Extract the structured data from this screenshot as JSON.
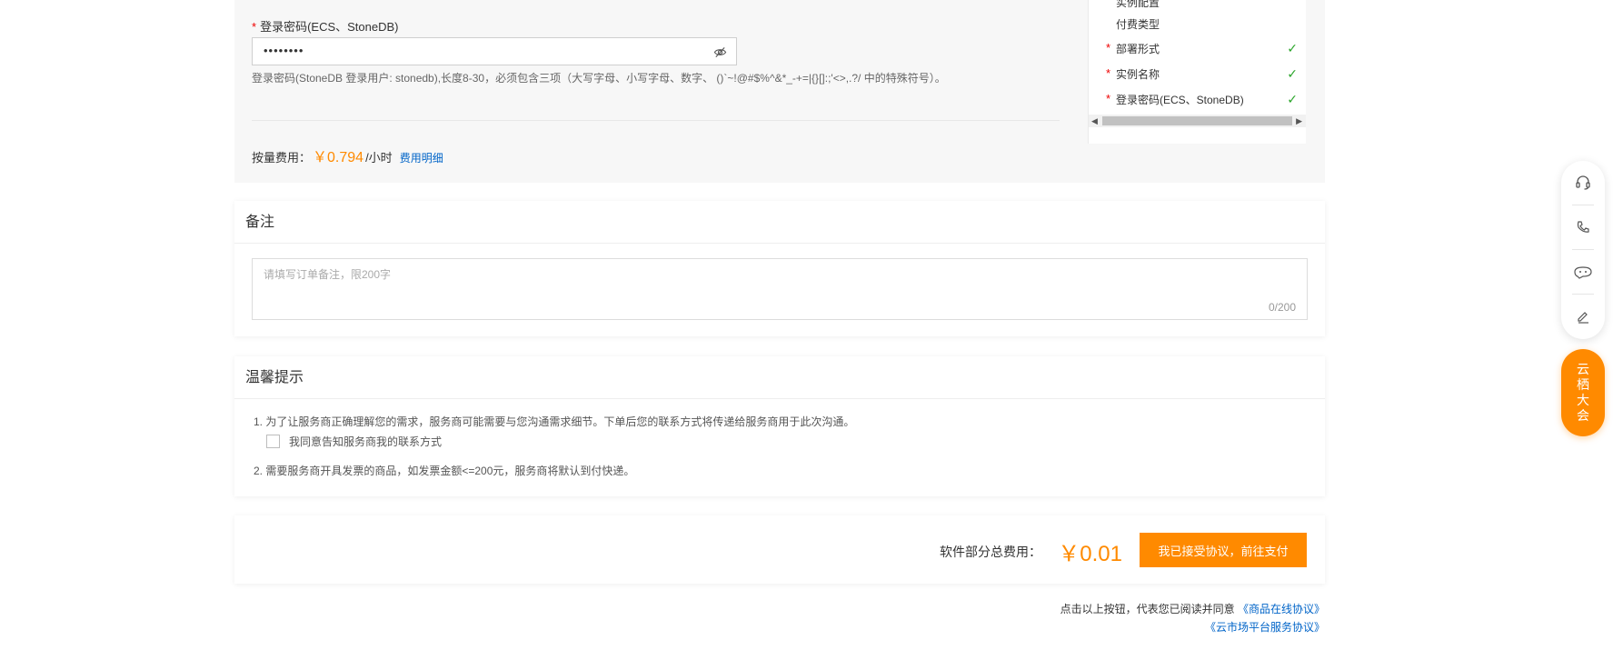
{
  "top_section": {
    "password_label": "登录密码(ECS、StoneDB)",
    "password_value": "••••••••",
    "password_hint": "登录密码(StoneDB 登录用户: stonedb),长度8-30，必须包含三项（大写字母、小写字母、数字、 ()`~!@#$%^&*_-+=|{}[]:;'<>,.?/ 中的特殊符号）。",
    "price_label": "按量费用：",
    "price_value": "￥0.794",
    "price_unit": "/小时",
    "price_link": "费用明细"
  },
  "nav_panel": {
    "items": [
      {
        "label": "实例配置",
        "required": false,
        "done": false
      },
      {
        "label": "付费类型",
        "required": false,
        "done": false
      },
      {
        "label": "部署形式",
        "required": true,
        "done": true
      },
      {
        "label": "实例名称",
        "required": true,
        "done": true
      },
      {
        "label": "登录密码(ECS、StoneDB)",
        "required": true,
        "done": true
      }
    ],
    "check_mark": "✓",
    "required_mark": "*"
  },
  "remarks": {
    "title": "备注",
    "placeholder": "请填写订单备注，限200字",
    "counter": "0/200"
  },
  "tips": {
    "title": "温馨提示",
    "line1": "1. 为了让服务商正确理解您的需求，服务商可能需要与您沟通需求细节。下单后您的联系方式将传递给服务商用于此次沟通。",
    "agree_label": "我同意告知服务商我的联系方式",
    "line2": "2. 需要服务商开具发票的商品，如发票金额<=200元，服务商将默认到付快递。"
  },
  "payment": {
    "total_label": "软件部分总费用：",
    "total_value": "￥0.01",
    "button_label": "我已接受协议，前往支付"
  },
  "agreement": {
    "note": "点击以上按钮，代表您已阅读并同意",
    "link1": "《商品在线协议》",
    "link2": "《云市场平台服务协议》"
  },
  "float_toolbar": {
    "icons": [
      "headset-icon",
      "phone-icon",
      "chat-icon",
      "edit-icon"
    ],
    "promo_chars": [
      "云",
      "栖",
      "大",
      "会"
    ]
  },
  "colors": {
    "accent": "#ff8a00",
    "link": "#0064c8",
    "success": "#2aa52a",
    "required": "#ee0000"
  }
}
